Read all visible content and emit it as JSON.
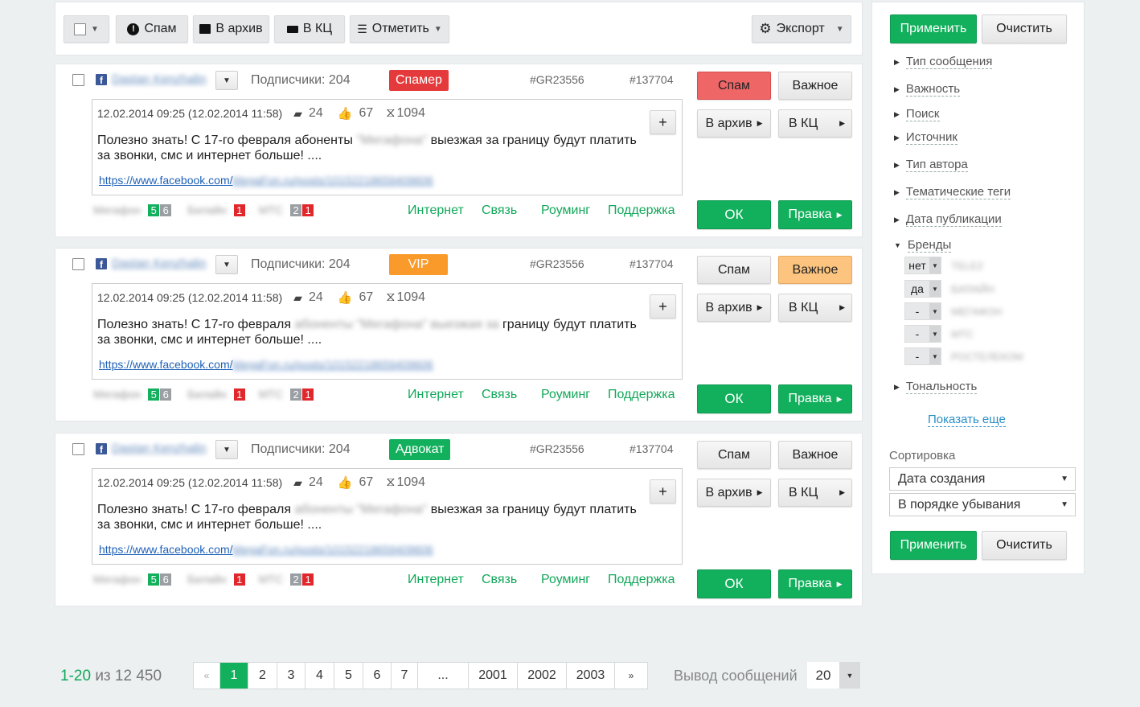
{
  "toolbar": {
    "spam": "Спам",
    "archive": "В архив",
    "kc": "В КЦ",
    "mark": "Отметить",
    "export": "Экспорт"
  },
  "cards": [
    {
      "author": "Dastan Kenzhalin",
      "subscribers": "Подписчики: 204",
      "badge": "Спамер",
      "badge_color": "#e53a3b",
      "gr": "#GR23556",
      "id": "#137704",
      "date": "12.02.2014 09:25 (12.02.2014 11:58)",
      "comments": "24",
      "likes": "67",
      "shares": "1094",
      "msg_a": "Полезно знать! С 17-го февраля абоненты ",
      "msg_blur": "\"Мегафона\" ",
      "msg_b": "выезжая за границу будут платить за звонки, смс и интернет больше! ....",
      "link": "https://www.facebook.com/",
      "link_blur": "MegaFon.ru/posts/10152218659409606",
      "spam_btn": "Спам",
      "important_btn": "Важное",
      "archive_btn": "В архив",
      "kc_btn": "В КЦ",
      "ok_btn": "ОК",
      "edit_btn": "Правка",
      "plus": "+",
      "brands": [
        {
          "name": "Мегафон",
          "nums": [
            "5",
            "6"
          ]
        },
        {
          "name": "Билайн",
          "nums": [
            "1"
          ]
        },
        {
          "name": "МТС",
          "nums": [
            "2",
            "1"
          ]
        }
      ],
      "topics": [
        "Интернет",
        "Связь",
        "Роуминг",
        "Поддержка"
      ]
    },
    {
      "author": "Dastan Kenzhalin",
      "subscribers": "Подписчики: 204",
      "badge": "VIP",
      "badge_color": "#f99a2b",
      "gr": "#GR23556",
      "id": "#137704",
      "date": "12.02.2014 09:25 (12.02.2014 11:58)",
      "comments": "24",
      "likes": "67",
      "shares": "1094",
      "msg_a": "Полезно знать! С 17-го февраля ",
      "msg_blur": "абоненты \"Мегафона\" выезжая за ",
      "msg_b": "границу будут платить за звонки, смс и интернет больше! ....",
      "link": "https://www.facebook.com/",
      "link_blur": "MegaFon.ru/posts/10152218659409606",
      "spam_btn": "Спам",
      "important_btn": "Важное",
      "archive_btn": "В архив",
      "kc_btn": "В КЦ",
      "ok_btn": "ОК",
      "edit_btn": "Правка",
      "plus": "+",
      "brands": [
        {
          "name": "Мегафон",
          "nums": [
            "5",
            "6"
          ]
        },
        {
          "name": "Билайн",
          "nums": [
            "1"
          ]
        },
        {
          "name": "МТС",
          "nums": [
            "2",
            "1"
          ]
        }
      ],
      "topics": [
        "Интернет",
        "Связь",
        "Роуминг",
        "Поддержка"
      ]
    },
    {
      "author": "Dastan Kenzhalin",
      "subscribers": "Подписчики: 204",
      "badge": "Адвокат",
      "badge_color": "#12b05c",
      "gr": "#GR23556",
      "id": "#137704",
      "date": "12.02.2014 09:25 (12.02.2014 11:58)",
      "comments": "24",
      "likes": "67",
      "shares": "1094",
      "msg_a": "Полезно знать! С 17-го февраля ",
      "msg_blur": "абоненты \"Мегафона\" ",
      "msg_b": "выезжая за границу будут платить за звонки, смс и интернет больше! ....",
      "link": "https://www.facebook.com/",
      "link_blur": "MegaFon.ru/posts/10152218659409606",
      "spam_btn": "Спам",
      "important_btn": "Важное",
      "archive_btn": "В архив",
      "kc_btn": "В КЦ",
      "ok_btn": "ОК",
      "edit_btn": "Правка",
      "plus": "+",
      "brands": [
        {
          "name": "Мегафон",
          "nums": [
            "5",
            "6"
          ]
        },
        {
          "name": "Билайн",
          "nums": [
            "1"
          ]
        },
        {
          "name": "МТС",
          "nums": [
            "2",
            "1"
          ]
        }
      ],
      "topics": [
        "Интернет",
        "Связь",
        "Роуминг",
        "Поддержка"
      ]
    }
  ],
  "sidebar": {
    "apply": "Применить",
    "clear": "Очистить",
    "filters": [
      "Тип сообщения",
      "Важность",
      "Поиск",
      "Источник",
      "Тип автора",
      "Тематические теги",
      "Дата публикации",
      "Бренды"
    ],
    "brand_filters": [
      {
        "value": "нет",
        "name": "TELE2"
      },
      {
        "value": "да",
        "name": "БИЛАЙН"
      },
      {
        "value": "-",
        "name": "МЕГАФОН"
      },
      {
        "value": "-",
        "name": "МТС"
      },
      {
        "value": "-",
        "name": "РОСТЕЛЕКОМ"
      }
    ],
    "tonality": "Тональность",
    "show_more": "Показать еще",
    "sort_label": "Сортировка",
    "sort_by": "Дата создания",
    "sort_order": "В порядке убывания"
  },
  "footer": {
    "range": "1-20",
    "of_total": "из 12 450",
    "pages": [
      "«",
      "1",
      "2",
      "3",
      "4",
      "5",
      "6",
      "7",
      "...",
      "2001",
      "2002",
      "2003",
      "»"
    ],
    "active_page": "1",
    "per_page_label": "Вывод сообщений",
    "per_page": "20"
  },
  "colors": {
    "accent": "#12b05c",
    "spam_active": "#ef6667",
    "important_active": "#fcc47e",
    "background": "#ecf0f1"
  }
}
